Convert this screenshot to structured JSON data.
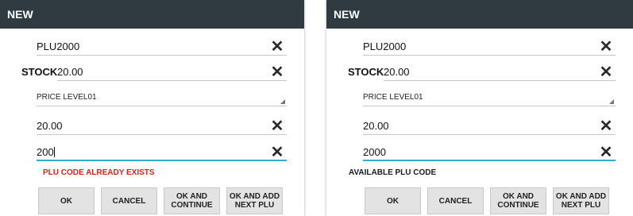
{
  "left": {
    "title": "NEW",
    "plu_value": "PLU2000",
    "stock_label": "STOCK",
    "stock_value": "20.00",
    "price_level": "PRICE LEVEL01",
    "price_value": "20.00",
    "plu_code_value": "200",
    "message": "PLU CODE ALREADY EXISTS",
    "message_color": "#e0201b",
    "buttons": {
      "ok": "OK",
      "cancel": "CANCEL",
      "ok_continue": "OK AND CONTINUE",
      "ok_next": "OK AND ADD NEXT PLU"
    }
  },
  "right": {
    "title": "NEW",
    "plu_value": "PLU2000",
    "stock_label": "STOCK",
    "stock_value": "20.00",
    "price_level": "PRICE LEVEL01",
    "price_value": "20.00",
    "plu_code_value": "2000",
    "message": "AVAILABLE PLU CODE",
    "message_color": "#1a1a1a",
    "buttons": {
      "ok": "OK",
      "cancel": "CANCEL",
      "ok_continue": "OK AND CONTINUE",
      "ok_next": "OK AND ADD NEXT PLU"
    }
  },
  "icons": {
    "clear": "close-icon",
    "dropdown": "dropdown-arrow-icon"
  },
  "colors": {
    "titlebar": "#2f3b40",
    "focus_underline": "#37a8d6",
    "button_bg": "#e3e3e3"
  }
}
